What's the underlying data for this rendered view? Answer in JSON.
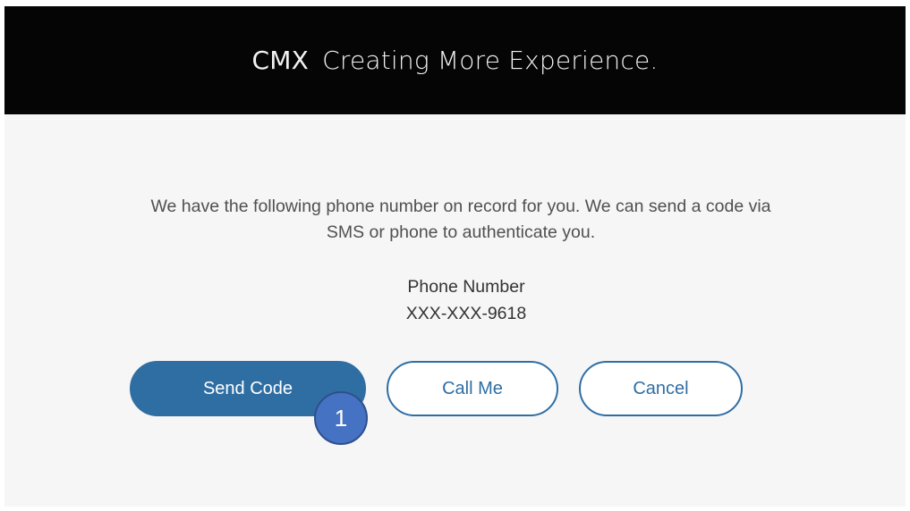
{
  "header": {
    "brand": "CMX",
    "tagline": "Creating More Experience."
  },
  "main": {
    "message": "We have the following phone number on record for you. We can send a code via SMS or phone to authenticate you.",
    "phone_label": "Phone Number",
    "phone_value": "XXX-XXX-9618"
  },
  "actions": {
    "send_code_label": "Send Code",
    "call_me_label": "Call Me",
    "cancel_label": "Cancel"
  },
  "annotation": {
    "step_number": "1"
  },
  "colors": {
    "header_bg": "#050505",
    "primary": "#2f6ea3",
    "badge": "#4672c4"
  }
}
